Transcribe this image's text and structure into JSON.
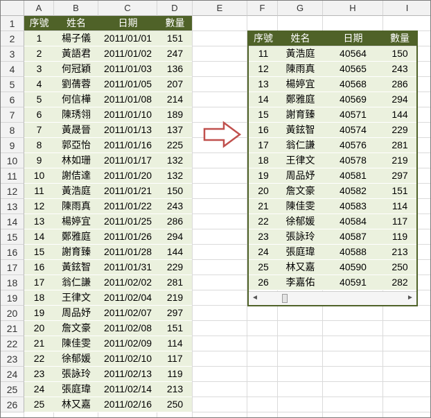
{
  "columns": [
    "A",
    "B",
    "C",
    "D",
    "E",
    "F",
    "G",
    "H",
    "I"
  ],
  "rows": [
    "1",
    "2",
    "3",
    "4",
    "5",
    "6",
    "7",
    "8",
    "9",
    "10",
    "11",
    "12",
    "13",
    "14",
    "15",
    "16",
    "17",
    "18",
    "19",
    "20",
    "21",
    "22",
    "23",
    "24",
    "25",
    "26"
  ],
  "left_table": {
    "headers": [
      "序號",
      "姓名",
      "日期",
      "數量"
    ],
    "records": [
      [
        "1",
        "楊子儀",
        "2011/01/01",
        "151"
      ],
      [
        "2",
        "黃語君",
        "2011/01/02",
        "247"
      ],
      [
        "3",
        "何冠穎",
        "2011/01/03",
        "136"
      ],
      [
        "4",
        "劉蒨蓉",
        "2011/01/05",
        "207"
      ],
      [
        "5",
        "何信樺",
        "2011/01/08",
        "214"
      ],
      [
        "6",
        "陳琇翎",
        "2011/01/10",
        "189"
      ],
      [
        "7",
        "黃晟晉",
        "2011/01/13",
        "137"
      ],
      [
        "8",
        "郭亞怡",
        "2011/01/16",
        "225"
      ],
      [
        "9",
        "林如珊",
        "2011/01/17",
        "132"
      ],
      [
        "10",
        "謝佶達",
        "2011/01/20",
        "132"
      ],
      [
        "11",
        "黃浩庭",
        "2011/01/21",
        "150"
      ],
      [
        "12",
        "陳雨真",
        "2011/01/22",
        "243"
      ],
      [
        "13",
        "楊婷宜",
        "2011/01/25",
        "286"
      ],
      [
        "14",
        "鄭雅庭",
        "2011/01/26",
        "294"
      ],
      [
        "15",
        "謝育臻",
        "2011/01/28",
        "144"
      ],
      [
        "16",
        "黃鉉智",
        "2011/01/31",
        "229"
      ],
      [
        "17",
        "翁仁謙",
        "2011/02/02",
        "281"
      ],
      [
        "18",
        "王律文",
        "2011/02/04",
        "219"
      ],
      [
        "19",
        "周品妤",
        "2011/02/07",
        "297"
      ],
      [
        "20",
        "詹文豪",
        "2011/02/08",
        "151"
      ],
      [
        "21",
        "陳佳雯",
        "2011/02/09",
        "114"
      ],
      [
        "22",
        "徐郁媛",
        "2011/02/10",
        "117"
      ],
      [
        "23",
        "張詠玲",
        "2011/02/13",
        "119"
      ],
      [
        "24",
        "張庭瑋",
        "2011/02/14",
        "213"
      ],
      [
        "25",
        "林又嘉",
        "2011/02/16",
        "250"
      ]
    ]
  },
  "right_table": {
    "headers": [
      "序號",
      "姓名",
      "日期",
      "數量"
    ],
    "records": [
      [
        "11",
        "黃浩庭",
        "40564",
        "150"
      ],
      [
        "12",
        "陳雨真",
        "40565",
        "243"
      ],
      [
        "13",
        "楊婷宜",
        "40568",
        "286"
      ],
      [
        "14",
        "鄭雅庭",
        "40569",
        "294"
      ],
      [
        "15",
        "謝育臻",
        "40571",
        "144"
      ],
      [
        "16",
        "黃鉉智",
        "40574",
        "229"
      ],
      [
        "17",
        "翁仁謙",
        "40576",
        "281"
      ],
      [
        "18",
        "王律文",
        "40578",
        "219"
      ],
      [
        "19",
        "周品妤",
        "40581",
        "297"
      ],
      [
        "20",
        "詹文豪",
        "40582",
        "151"
      ],
      [
        "21",
        "陳佳雯",
        "40583",
        "114"
      ],
      [
        "22",
        "徐郁媛",
        "40584",
        "117"
      ],
      [
        "23",
        "張詠玲",
        "40587",
        "119"
      ],
      [
        "24",
        "張庭瑋",
        "40588",
        "213"
      ],
      [
        "25",
        "林又嘉",
        "40590",
        "250"
      ],
      [
        "26",
        "李嘉佑",
        "40591",
        "282"
      ]
    ]
  },
  "scrollbar": {
    "left_arrow": "◄",
    "right_arrow": "►"
  },
  "colors": {
    "header_bg": "#4f6228",
    "band_bg": "#ebf1de",
    "arrow_stroke": "#c0504d"
  },
  "icons": {
    "arrow": "right-arrow-icon"
  }
}
